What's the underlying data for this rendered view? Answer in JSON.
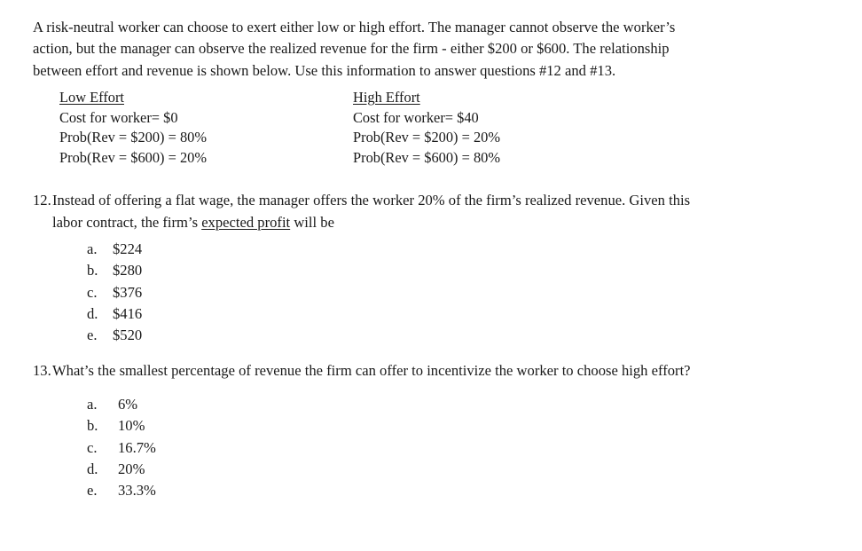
{
  "intro": {
    "lines": [
      "A risk-neutral worker can choose to exert either low or high effort. The manager cannot observe the worker’s",
      "action, but the manager can observe the realized revenue for the firm - either $200 or $600. The relationship",
      "between effort and revenue is shown below. Use this information to answer questions #12 and #13."
    ]
  },
  "effort_table": {
    "columns": [
      {
        "header": "Low Effort",
        "cost_line": "Cost for worker= $0",
        "prob_200_line": "Prob(Rev = $200) = 80%",
        "prob_600_line": "Prob(Rev = $600) = 20%"
      },
      {
        "header": "High Effort",
        "cost_line": "Cost for worker= $40",
        "prob_200_line": "Prob(Rev = $200) = 20%",
        "prob_600_line": "Prob(Rev = $600) = 80%"
      }
    ]
  },
  "questions": [
    {
      "number": "12.",
      "line1": "Instead of offering a flat wage, the manager offers the worker 20% of the firm’s realized revenue. Given this",
      "line2_prefix": "labor contract, the firm’s ",
      "line2_underlined": "expected profit",
      "line2_suffix": " will be",
      "options": [
        {
          "letter": "a.",
          "text": "$224"
        },
        {
          "letter": "b.",
          "text": "$280"
        },
        {
          "letter": "c.",
          "text": "$376"
        },
        {
          "letter": "d.",
          "text": "$416"
        },
        {
          "letter": "e.",
          "text": "$520"
        }
      ]
    },
    {
      "number": "13.",
      "line1": "What’s the smallest percentage of revenue the firm can offer to incentivize the worker to choose high effort?",
      "options": [
        {
          "letter": "a.",
          "text": "6%"
        },
        {
          "letter": "b.",
          "text": "10%"
        },
        {
          "letter": "c.",
          "text": "16.7%"
        },
        {
          "letter": "d.",
          "text": "20%"
        },
        {
          "letter": "e.",
          "text": "33.3%"
        }
      ]
    }
  ]
}
